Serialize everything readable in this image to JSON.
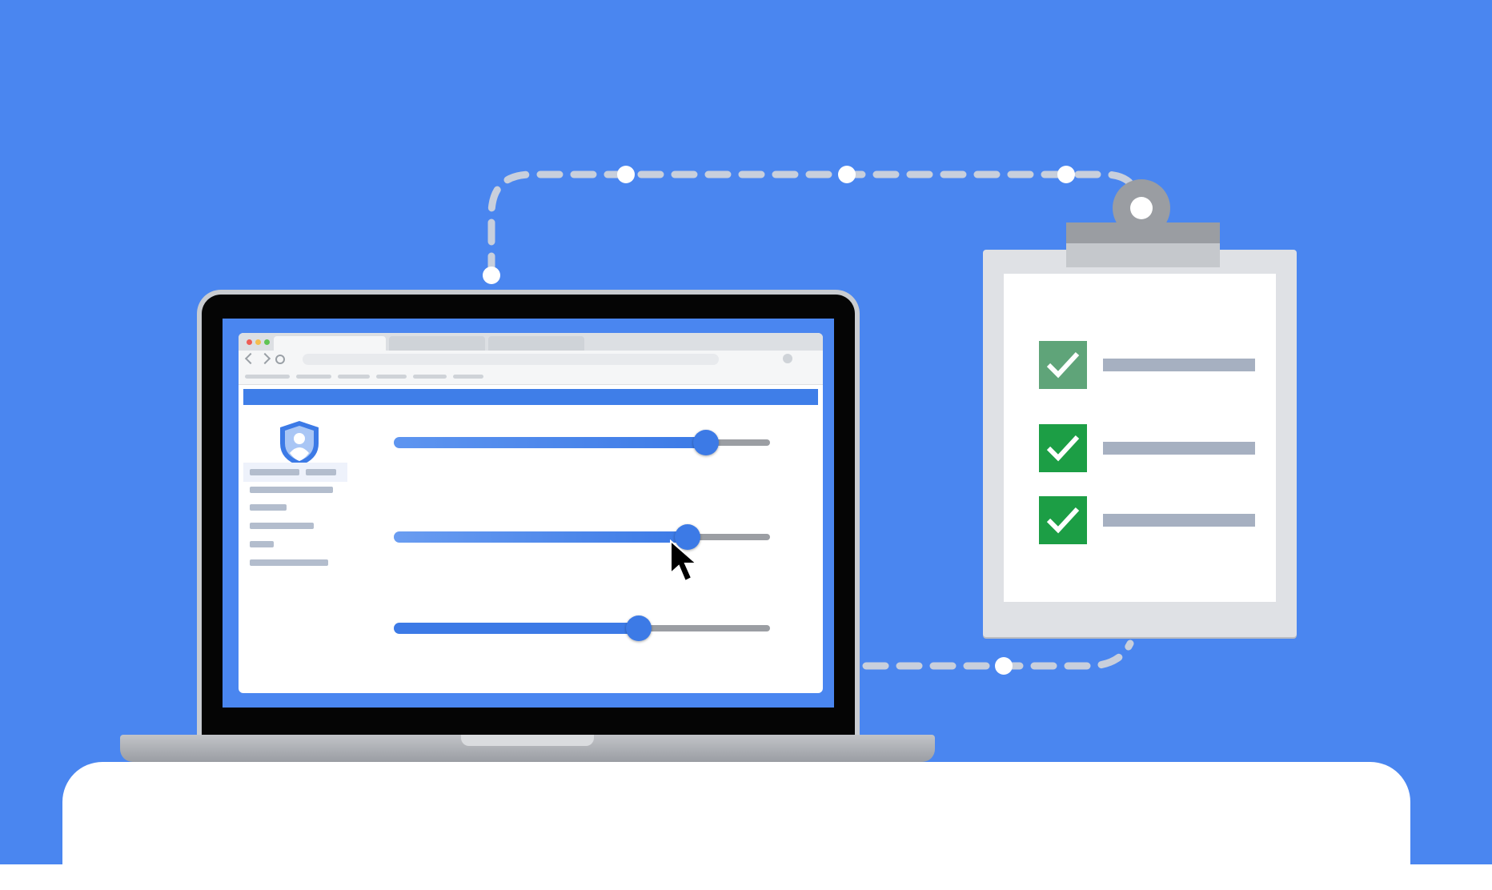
{
  "scene": {
    "background_color": "#4a86f0",
    "accent_color": "#3c7ae6",
    "success_color": "#1c9e45"
  },
  "laptop": {
    "icons": [
      "shield-user-icon",
      "mouse-cursor-icon"
    ],
    "sliders": [
      {
        "value_percent": 83
      },
      {
        "value_percent": 78
      },
      {
        "value_percent": 65
      }
    ]
  },
  "clipboard": {
    "items": [
      {
        "checked": true
      },
      {
        "checked": true
      },
      {
        "checked": true
      }
    ]
  }
}
